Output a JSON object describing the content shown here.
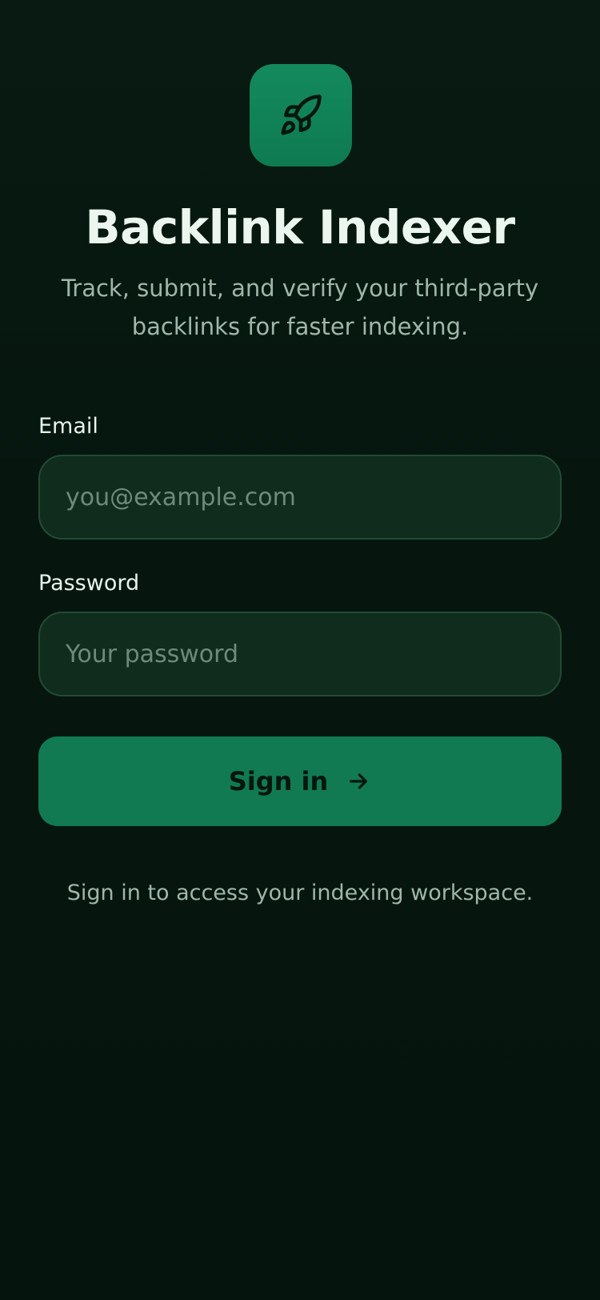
{
  "app": {
    "title": "Backlink Indexer",
    "subtitle": "Track, submit, and verify your third-party backlinks for faster indexing.",
    "logo_icon": "rocket-icon"
  },
  "form": {
    "email_label": "Email",
    "email_placeholder": "you@example.com",
    "email_value": "",
    "password_label": "Password",
    "password_placeholder": "Your password",
    "password_value": "",
    "submit_label": "Sign in",
    "submit_icon": "arrow-right-icon"
  },
  "footer": {
    "note": "Sign in to access your indexing workspace."
  },
  "colors": {
    "background": "#06160f",
    "accent": "#117a53",
    "field_bg": "#0f2c1d",
    "field_border": "#234a34",
    "text_primary": "#eaf6ee",
    "text_muted": "#9fb7a8"
  }
}
